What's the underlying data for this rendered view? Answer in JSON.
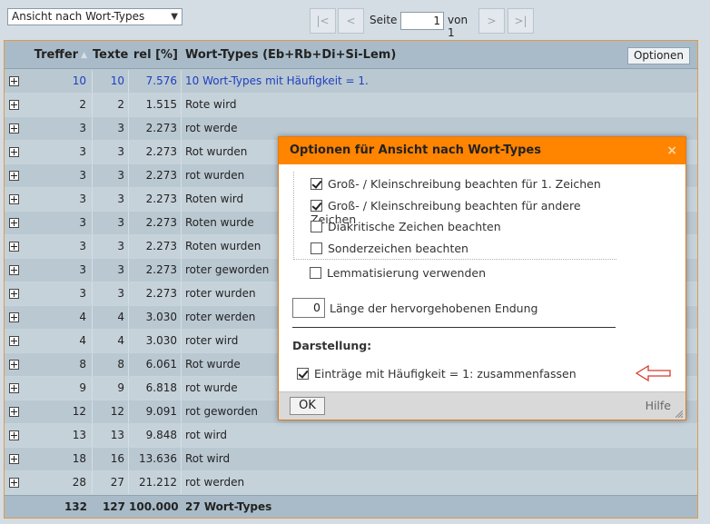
{
  "toolbar": {
    "view_select_value": "Ansicht nach Wort-Types",
    "pager": {
      "first": "|<",
      "prev": "<",
      "label_seite": "Seite",
      "page": "1",
      "label_von": "von 1",
      "next": ">",
      "last": ">|"
    }
  },
  "table": {
    "headers": {
      "treffer": "Treffer",
      "texte": "Texte",
      "rel": "rel [%]",
      "wort_types": "Wort-Types (Eb+Rb+Di+Si-Lem)",
      "options_button": "Optionen"
    },
    "rows": [
      {
        "treffer": "10",
        "texte": "10",
        "rel": "7.576",
        "wort": "10 Wort-Types mit Häufigkeit = 1."
      },
      {
        "treffer": "2",
        "texte": "2",
        "rel": "1.515",
        "wort": "Rote wird"
      },
      {
        "treffer": "3",
        "texte": "3",
        "rel": "2.273",
        "wort": "rot werde"
      },
      {
        "treffer": "3",
        "texte": "3",
        "rel": "2.273",
        "wort": "Rot wurden"
      },
      {
        "treffer": "3",
        "texte": "3",
        "rel": "2.273",
        "wort": "rot wurden"
      },
      {
        "treffer": "3",
        "texte": "3",
        "rel": "2.273",
        "wort": "Roten wird"
      },
      {
        "treffer": "3",
        "texte": "3",
        "rel": "2.273",
        "wort": "Roten wurde"
      },
      {
        "treffer": "3",
        "texte": "3",
        "rel": "2.273",
        "wort": "Roten wurden"
      },
      {
        "treffer": "3",
        "texte": "3",
        "rel": "2.273",
        "wort": "roter geworden"
      },
      {
        "treffer": "3",
        "texte": "3",
        "rel": "2.273",
        "wort": "roter wurden"
      },
      {
        "treffer": "4",
        "texte": "4",
        "rel": "3.030",
        "wort": "roter werden"
      },
      {
        "treffer": "4",
        "texte": "4",
        "rel": "3.030",
        "wort": "roter wird"
      },
      {
        "treffer": "8",
        "texte": "8",
        "rel": "6.061",
        "wort": "Rot wurde"
      },
      {
        "treffer": "9",
        "texte": "9",
        "rel": "6.818",
        "wort": "rot wurde"
      },
      {
        "treffer": "12",
        "texte": "12",
        "rel": "9.091",
        "wort": "rot geworden"
      },
      {
        "treffer": "13",
        "texte": "13",
        "rel": "9.848",
        "wort": "rot wird"
      },
      {
        "treffer": "18",
        "texte": "16",
        "rel": "13.636",
        "wort": "Rot wird"
      },
      {
        "treffer": "28",
        "texte": "27",
        "rel": "21.212",
        "wort": "rot werden"
      }
    ],
    "footer": {
      "treffer": "132",
      "texte": "127",
      "rel": "100.000",
      "wort": "27 Wort-Types"
    }
  },
  "dialog": {
    "title": "Optionen für Ansicht nach Wort-Types",
    "close": "×",
    "options": [
      {
        "label": "Groß- / Kleinschreibung beachten für 1. Zeichen",
        "checked": true
      },
      {
        "label": "Groß- / Kleinschreibung beachten für andere Zeichen",
        "checked": true
      },
      {
        "label": "Diakritische Zeichen beachten",
        "checked": false
      },
      {
        "label": "Sonderzeichen beachten",
        "checked": false
      }
    ],
    "lemma": {
      "label": "Lemmatisierung verwenden",
      "checked": false
    },
    "ending_length": {
      "value": "0",
      "label": "Länge der hervorgehobenen Endung"
    },
    "section_title": "Darstellung:",
    "merge": {
      "label": "Einträge mit Häufigkeit = 1: zusammenfassen",
      "checked": true
    },
    "ok": "OK",
    "help": "Hilfe"
  },
  "colors": {
    "accent": "#ff8400",
    "link": "#1e3fbf",
    "annotation_arrow": "#d23b2a"
  }
}
